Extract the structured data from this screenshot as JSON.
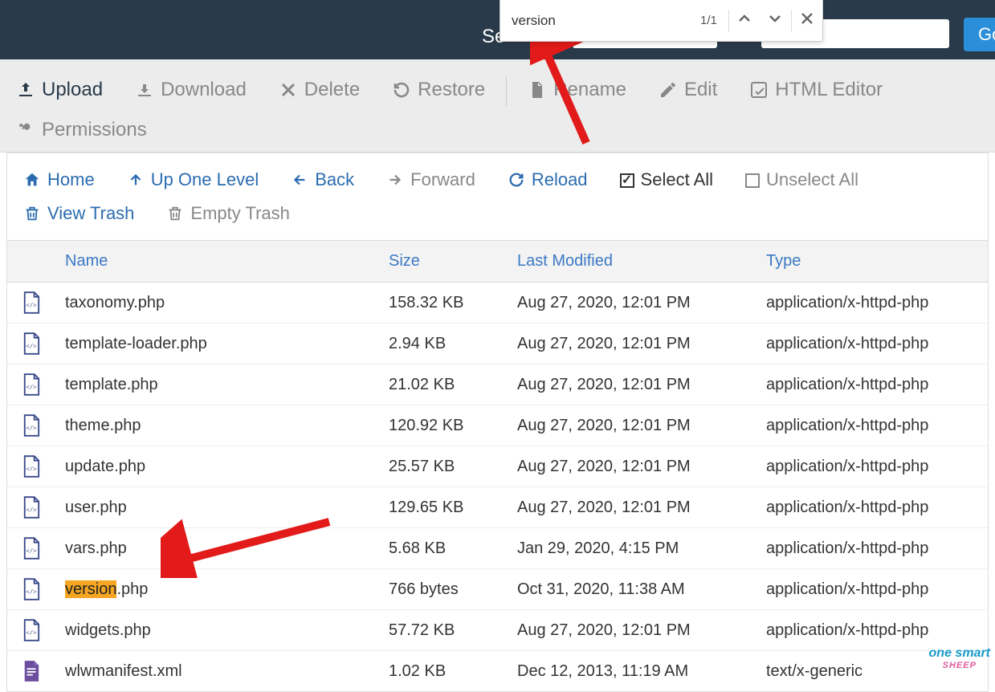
{
  "topbar": {
    "label_fragment": "Se",
    "go_label": "Go"
  },
  "find": {
    "query": "version",
    "count": "1/1"
  },
  "toolbar": {
    "upload": "Upload",
    "download": "Download",
    "delete": "Delete",
    "restore": "Restore",
    "rename": "Rename",
    "edit": "Edit",
    "html_editor": "HTML Editor",
    "permissions": "Permissions"
  },
  "navbar": {
    "home": "Home",
    "up": "Up One Level",
    "back": "Back",
    "forward": "Forward",
    "reload": "Reload",
    "select_all": "Select All",
    "unselect_all": "Unselect All",
    "view_trash": "View Trash",
    "empty_trash": "Empty Trash"
  },
  "columns": {
    "name": "Name",
    "size": "Size",
    "modified": "Last Modified",
    "type": "Type"
  },
  "files": [
    {
      "name": "taxonomy.php",
      "size": "158.32 KB",
      "modified": "Aug 27, 2020, 12:01 PM",
      "type": "application/x-httpd-php",
      "icon": "php"
    },
    {
      "name": "template-loader.php",
      "size": "2.94 KB",
      "modified": "Aug 27, 2020, 12:01 PM",
      "type": "application/x-httpd-php",
      "icon": "php"
    },
    {
      "name": "template.php",
      "size": "21.02 KB",
      "modified": "Aug 27, 2020, 12:01 PM",
      "type": "application/x-httpd-php",
      "icon": "php"
    },
    {
      "name": "theme.php",
      "size": "120.92 KB",
      "modified": "Aug 27, 2020, 12:01 PM",
      "type": "application/x-httpd-php",
      "icon": "php"
    },
    {
      "name": "update.php",
      "size": "25.57 KB",
      "modified": "Aug 27, 2020, 12:01 PM",
      "type": "application/x-httpd-php",
      "icon": "php"
    },
    {
      "name": "user.php",
      "size": "129.65 KB",
      "modified": "Aug 27, 2020, 12:01 PM",
      "type": "application/x-httpd-php",
      "icon": "php"
    },
    {
      "name": "vars.php",
      "size": "5.68 KB",
      "modified": "Jan 29, 2020, 4:15 PM",
      "type": "application/x-httpd-php",
      "icon": "php"
    },
    {
      "name_pre": "version",
      "name_post": ".php",
      "size": "766 bytes",
      "modified": "Oct 31, 2020, 11:38 AM",
      "type": "application/x-httpd-php",
      "icon": "php",
      "highlight": true
    },
    {
      "name": "widgets.php",
      "size": "57.72 KB",
      "modified": "Aug 27, 2020, 12:01 PM",
      "type": "application/x-httpd-php",
      "icon": "php"
    },
    {
      "name": "wlwmanifest.xml",
      "size": "1.02 KB",
      "modified": "Dec 12, 2013, 11:19 AM",
      "type": "text/x-generic",
      "icon": "xml"
    }
  ],
  "watermark": {
    "line1": "one smart",
    "line2": "SHEEP"
  }
}
